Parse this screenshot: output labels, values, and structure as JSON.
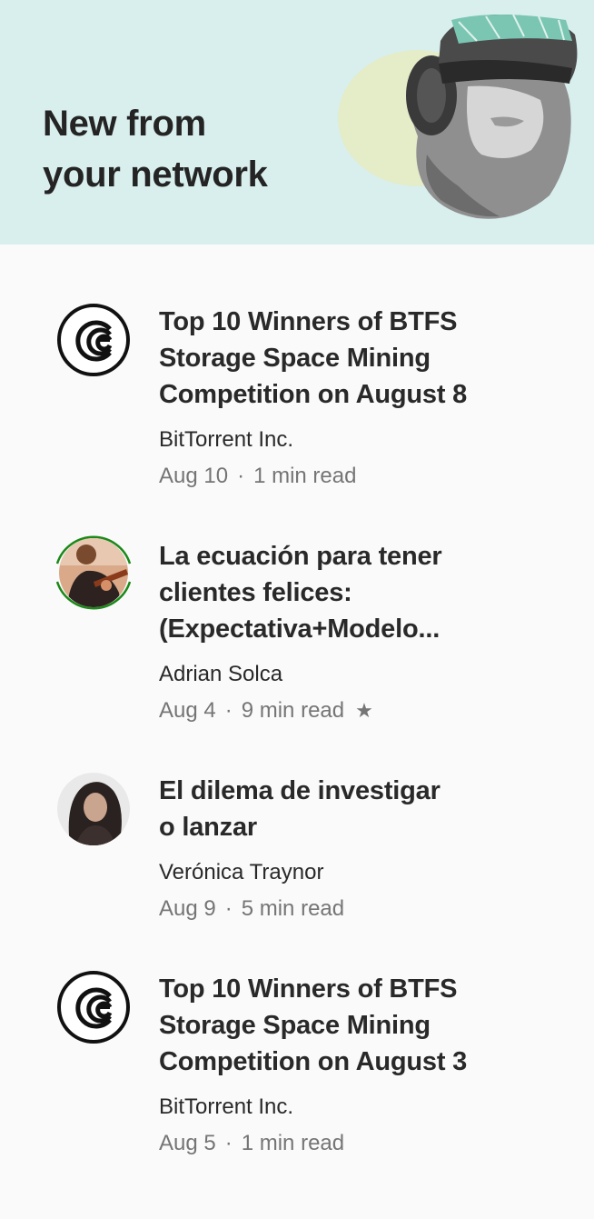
{
  "header": {
    "title_line1": "New from",
    "title_line2": "your network",
    "illustration_icon": "vr-headset-person-illustration",
    "background_color": "#d9efee"
  },
  "stories": [
    {
      "avatar_icon": "bittorrent-logo-icon",
      "title_lines": [
        "Top 10 Winners of BTFS",
        "Storage Space Mining",
        "Competition on August 8"
      ],
      "author": "BitTorrent Inc.",
      "date": "Aug 10",
      "separator": "·",
      "read_time": "1 min read",
      "starred": false
    },
    {
      "avatar_icon": "author-photo-avatar",
      "title_lines": [
        "La ecuación para tener",
        "clientes felices:",
        "(Expectativa+Modelo..."
      ],
      "author": "Adrian Solca",
      "date": "Aug 4",
      "separator": "·",
      "read_time": "9 min read",
      "star": "★",
      "starred": true
    },
    {
      "avatar_icon": "author-photo-avatar",
      "title_lines": [
        "El dilema de investigar",
        "o lanzar"
      ],
      "author": "Verónica Traynor",
      "date": "Aug 9",
      "separator": "·",
      "read_time": "5 min read",
      "starred": false
    },
    {
      "avatar_icon": "bittorrent-logo-icon",
      "title_lines": [
        "Top 10 Winners of BTFS",
        "Storage Space Mining",
        "Competition on August 3"
      ],
      "author": "BitTorrent Inc.",
      "date": "Aug 5",
      "separator": "·",
      "read_time": "1 min read",
      "starred": false
    }
  ],
  "colors": {
    "accent_ring": "#1a8917",
    "meta_gray": "#757575"
  }
}
